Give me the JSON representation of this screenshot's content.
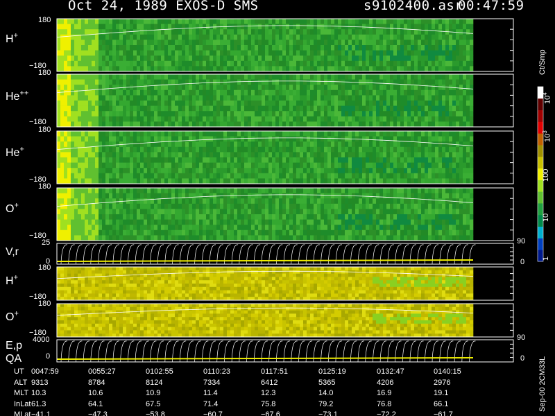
{
  "chart_data": {
    "type": "heatmap",
    "title": "Oct 24, 1989   EXOS-D SMS",
    "file_id": "s9102400.asr",
    "time_readout": "00:47:59",
    "colorbar": {
      "unit": "Ct/Smp",
      "scale": "log",
      "range": [
        1,
        10000
      ],
      "tick_labels": [
        "1",
        "10",
        "100",
        "10",
        "10"
      ],
      "tick_exponents": [
        "",
        "",
        "",
        "3",
        "4"
      ],
      "colors": [
        "#001a8c",
        "#0040c0",
        "#00b0d0",
        "#008a4a",
        "#20a040",
        "#60c030",
        "#a0e020",
        "#f0f000",
        "#c8c000",
        "#a09000",
        "#c06000",
        "#e00000",
        "#a00000",
        "#600000",
        "#ffffff"
      ]
    },
    "panels": [
      {
        "id": "h-plus",
        "species": "H",
        "charge": "+",
        "ymax": "180",
        "ymin": "−180",
        "kind": "pitch-angle"
      },
      {
        "id": "he-plus-plus",
        "species": "He",
        "charge": "++",
        "ymax": "180",
        "ymin": "−180",
        "kind": "pitch-angle"
      },
      {
        "id": "he-plus",
        "species": "He",
        "charge": "+",
        "ymax": "180",
        "ymin": "−180",
        "kind": "pitch-angle"
      },
      {
        "id": "o-plus",
        "species": "O",
        "charge": "+",
        "ymax": "180",
        "ymin": "−180",
        "kind": "pitch-angle"
      },
      {
        "id": "v-r",
        "label": "V,r",
        "ymax": "25",
        "ymin": "0",
        "right_max": "90",
        "right_min": "0",
        "kind": "line"
      },
      {
        "id": "h-plus-energy",
        "species": "H",
        "charge": "+",
        "ymax": "180",
        "ymin": "−180",
        "kind": "pitch-angle-yellow"
      },
      {
        "id": "o-plus-energy",
        "species": "O",
        "charge": "+",
        "ymax": "180",
        "ymin": "−180",
        "kind": "pitch-angle-yellow"
      },
      {
        "id": "e-p",
        "label": "E,p",
        "label2": "QA",
        "ymax": "4000",
        "ymin": "0",
        "right_max": "90",
        "right_min": "0",
        "kind": "line"
      }
    ],
    "x_axis": {
      "UT": [
        "0047:59",
        "0055:27",
        "0102:55",
        "0110:23",
        "0117:51",
        "0125:19",
        "0132:47",
        "0140:15"
      ],
      "ALT": [
        "9313",
        "8784",
        "8124",
        "7334",
        "6412",
        "5365",
        "4206",
        "2976"
      ],
      "MLT": [
        "10.3",
        "10.6",
        "10.9",
        "11.4",
        "12.3",
        "14.0",
        "16.9",
        "19.1"
      ],
      "InLat": [
        "61.3",
        "64.1",
        "67.5",
        "71.4",
        "75.8",
        "79.2",
        "76.8",
        "66.1"
      ],
      "MLat": [
        "−41.1",
        "−47.3",
        "−53.8",
        "−60.7",
        "−67.6",
        "−73.1",
        "−72.2",
        "−61.7"
      ]
    },
    "row_labels": [
      "UT",
      "ALT",
      "MLT",
      "InLat",
      "MLat"
    ],
    "footer_note": "Sep-00 2CM33L"
  }
}
